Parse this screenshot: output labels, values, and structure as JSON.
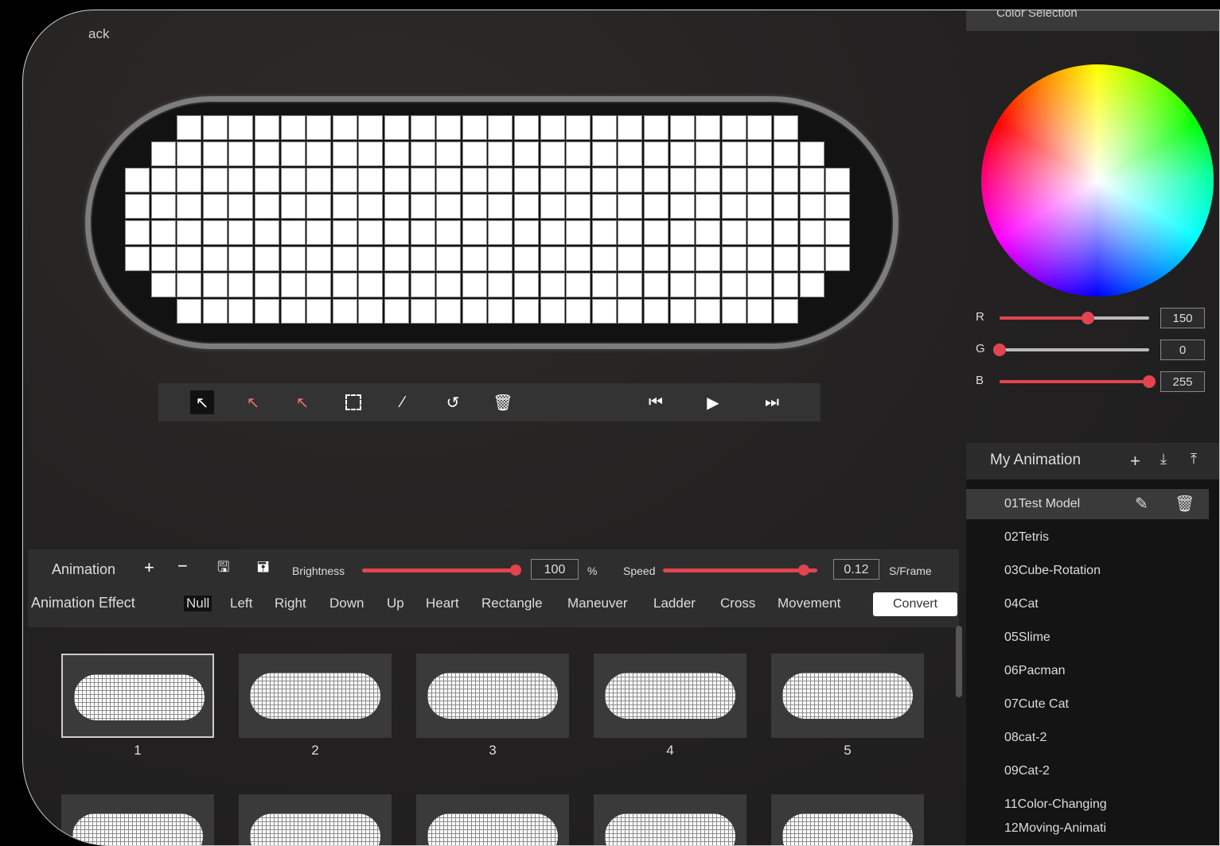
{
  "header": {
    "back_label": "ack"
  },
  "color_panel": {
    "title": "Color Selection",
    "channels": [
      {
        "label": "R",
        "value": "150",
        "fraction": 0.59
      },
      {
        "label": "G",
        "value": "0",
        "fraction": 0.0
      },
      {
        "label": "B",
        "value": "255",
        "fraction": 1.0
      }
    ]
  },
  "my_animation": {
    "title": "My Animation",
    "items": [
      "01Test Model",
      "02Tetris",
      "03Cube-Rotation",
      "04Cat",
      "05Slime",
      "06Pacman",
      "07Cute Cat",
      "08cat-2",
      "09Cat-2",
      "11Color-Changing",
      "12Moving-Animati"
    ]
  },
  "animation_bar": {
    "title": "Animation",
    "brightness_label": "Brightness",
    "brightness_value": "100",
    "brightness_unit": "%",
    "speed_label": "Speed",
    "speed_value": "0.12",
    "speed_unit": "S/Frame",
    "effect_label": "Animation Effect",
    "effects": [
      "Null",
      "Left",
      "Right",
      "Down",
      "Up",
      "Heart",
      "Rectangle",
      "Maneuver",
      "Ladder",
      "Cross",
      "Movement"
    ],
    "convert_label": "Convert"
  },
  "frames": [
    "1",
    "2",
    "3",
    "4",
    "5"
  ]
}
